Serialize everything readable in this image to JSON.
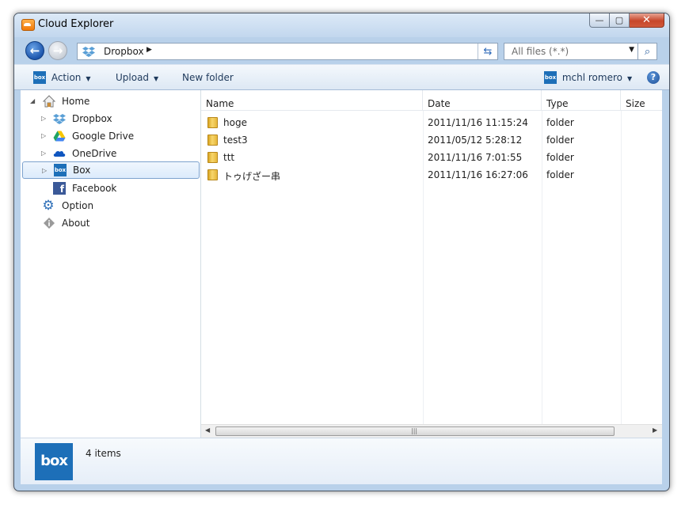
{
  "window": {
    "title": "Cloud Explorer"
  },
  "caption": {
    "min": "—",
    "max": "▢",
    "close": "✕"
  },
  "address": {
    "crumb": "Dropbox"
  },
  "filter": {
    "value": "All files (*.*)"
  },
  "toolbar": {
    "action_label": "Action",
    "upload_label": "Upload",
    "new_folder_label": "New folder",
    "account_label": "mchl romero",
    "box_logo": "box",
    "help": "?"
  },
  "tree": {
    "items": [
      {
        "label": "Home"
      },
      {
        "label": "Dropbox"
      },
      {
        "label": "Google Drive"
      },
      {
        "label": "OneDrive"
      },
      {
        "label": "Box",
        "selected": true
      },
      {
        "label": "Facebook"
      },
      {
        "label": "Option"
      },
      {
        "label": "About"
      }
    ]
  },
  "list": {
    "columns": [
      "Name",
      "Date",
      "Type",
      "Size"
    ],
    "rows": [
      {
        "name": "hoge",
        "date": "2011/11/16 11:15:24",
        "type": "folder"
      },
      {
        "name": "test3",
        "date": "2011/05/12 5:28:12",
        "type": "folder"
      },
      {
        "name": "ttt",
        "date": "2011/11/16 7:01:55",
        "type": "folder"
      },
      {
        "name": "トゥげざー串",
        "date": "2011/11/16 16:27:06",
        "type": "folder"
      }
    ]
  },
  "status": {
    "logo": "box",
    "count_text": "4 items"
  },
  "icons": {
    "home": "home-icon",
    "dropbox": "dropbox-icon",
    "google_drive": "google-drive-icon",
    "onedrive": "onedrive-icon",
    "box": "box-icon",
    "facebook": "facebook-icon",
    "option": "gear-icon",
    "about": "info-icon"
  },
  "colors": {
    "accent": "#1d6fb8",
    "selection_border": "#7da2ce",
    "window_frame": "#b9d1ea"
  }
}
